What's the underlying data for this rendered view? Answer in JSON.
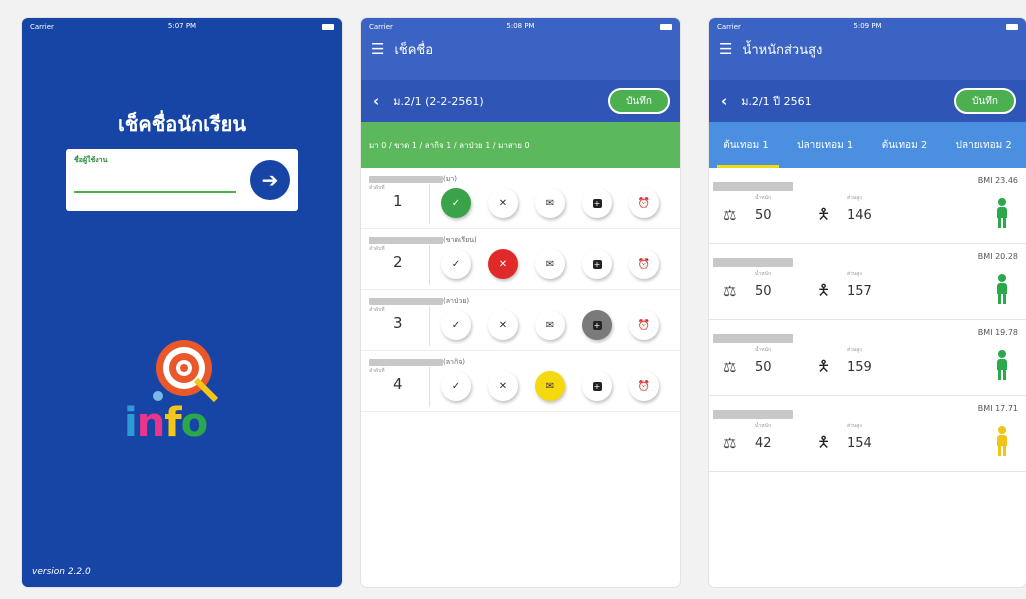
{
  "login": {
    "status": {
      "carrier": "Carrier",
      "time": "5:07 PM"
    },
    "title": "เช็คชื่อนักเรียน",
    "username_label": "ชื่อผู้ใช้งาน",
    "username_value": "",
    "logo_text": [
      "i",
      "n",
      "f",
      "o"
    ],
    "version": "version 2.2.0",
    "colors": {
      "background": "#1745a6",
      "accent": "#4caf50"
    }
  },
  "attendance": {
    "status": {
      "carrier": "Carrier",
      "time": "5:08 PM"
    },
    "title": "เช็คชื่อ",
    "class": "ม.2/1 (2-2-2561)",
    "save_label": "บันทึก",
    "summary": "มา 0 / ขาด 1 / ลากิจ 1 / ลาป่วย 1 / มาสาย 0",
    "number_label": "ลำดับที่",
    "students": [
      {
        "number": "1",
        "status": "(มา)",
        "selected": "present"
      },
      {
        "number": "2",
        "status": "(ขาดเรียน)",
        "selected": "absent"
      },
      {
        "number": "3",
        "status": "(ลาป่วย)",
        "selected": "sick"
      },
      {
        "number": "4",
        "status": "(ลากิจ)",
        "selected": "leave"
      }
    ],
    "action_icons": [
      "check-icon",
      "cross-icon",
      "envelope-icon",
      "plus-square-icon",
      "alarm-clock-icon"
    ]
  },
  "bmi": {
    "status": {
      "carrier": "Carrier",
      "time": "5:09 PM"
    },
    "title": "น้ำหนักส่วนสูง",
    "class": "ม.2/1 ปี 2561",
    "save_label": "บันทึก",
    "tabs": [
      "ต้นเทอม 1",
      "ปลายเทอม 1",
      "ต้นเทอม 2",
      "ปลายเทอม 2"
    ],
    "weight_label": "น้ำหนัก",
    "height_label": "ส่วนสูง",
    "students": [
      {
        "bmi": "BMI 23.46",
        "weight": "50",
        "height": "146",
        "color": "#2aa84a"
      },
      {
        "bmi": "BMI 20.28",
        "weight": "50",
        "height": "157",
        "color": "#2aa84a"
      },
      {
        "bmi": "BMI 19.78",
        "weight": "50",
        "height": "159",
        "color": "#2aa84a"
      },
      {
        "bmi": "BMI 17.71",
        "weight": "42",
        "height": "154",
        "color": "#f0c419"
      }
    ]
  }
}
